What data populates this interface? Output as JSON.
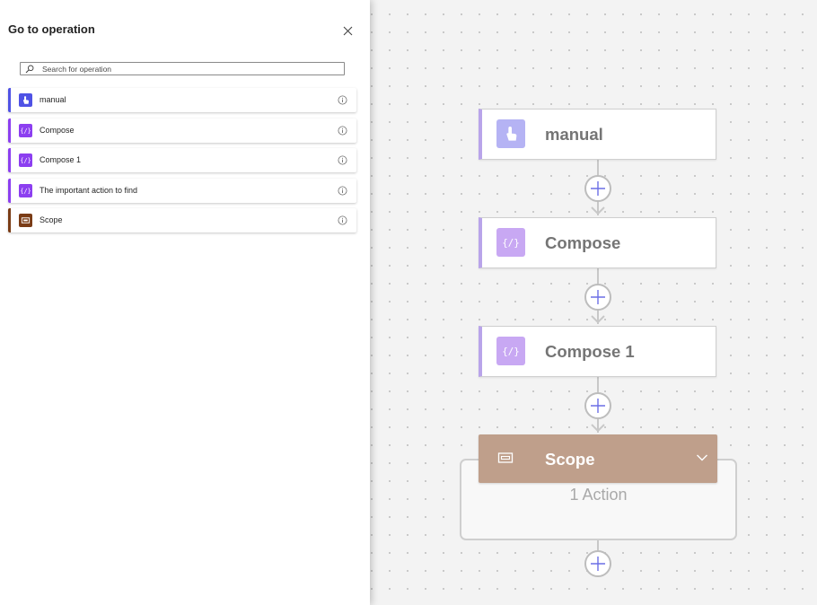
{
  "panel": {
    "title": "Go to operation",
    "search_placeholder": "Search for operation",
    "search_value": "",
    "operations": [
      {
        "label": "manual",
        "icon": "hand-touch-icon",
        "color": "#4f52e5"
      },
      {
        "label": "Compose",
        "icon": "compose-icon",
        "color": "#8c3ff0"
      },
      {
        "label": "Compose 1",
        "icon": "compose-icon",
        "color": "#8c3ff0"
      },
      {
        "label": "The important action to find",
        "icon": "compose-icon",
        "color": "#8c3ff0"
      },
      {
        "label": "Scope",
        "icon": "scope-icon",
        "color": "#7a3c16"
      }
    ]
  },
  "canvas": {
    "cards": [
      {
        "label": "manual",
        "icon": "hand-touch-icon",
        "icon_bg": "#b5b3f4"
      },
      {
        "label": "Compose",
        "icon": "compose-icon",
        "icon_bg": "#c8a8f3"
      },
      {
        "label": "Compose 1",
        "icon": "compose-icon",
        "icon_bg": "#c8a8f3"
      }
    ],
    "scope": {
      "label": "Scope",
      "count_text": "1 Action",
      "header_color": "#bf9f8b"
    }
  },
  "colors": {
    "accent_manual": "#4f52e5",
    "accent_compose": "#8c3ff0",
    "accent_scope": "#7a3c16",
    "card_border_accent": "#b9a4ea",
    "add_plus": "#6b6fe6"
  }
}
